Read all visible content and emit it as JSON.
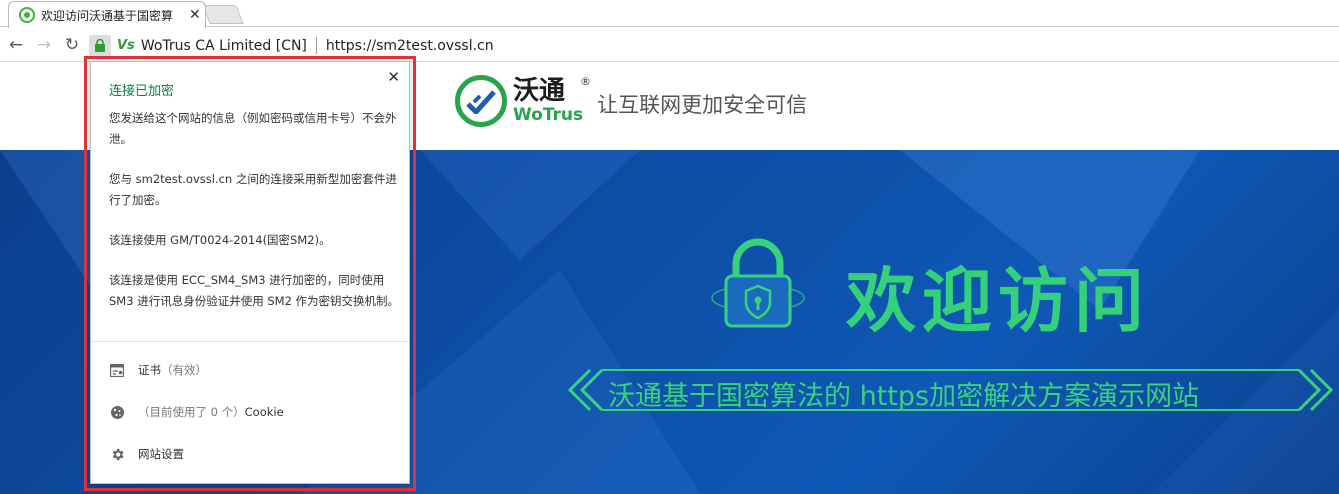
{
  "tab": {
    "title": "欢迎访问沃通基于国密算",
    "close_glyph": "✕"
  },
  "toolbar": {
    "back_glyph": "←",
    "forward_glyph": "→",
    "reload_glyph": "↻",
    "ev_logo_text": "Vs",
    "ev_name": "WoTrus CA Limited [CN]",
    "url": "https://sm2test.ovssl.cn"
  },
  "header": {
    "brand_cn": "沃通",
    "brand_en": "WoTrus",
    "registered": "®",
    "slogan": "让互联网更加安全可信"
  },
  "hero": {
    "title": "欢迎访问",
    "subtitle": "沃通基于国密算法的 https加密解决方案演示网站"
  },
  "popup": {
    "close_glyph": "✕",
    "title": "连接已加密",
    "paragraphs": [
      "您发送给这个网站的信息（例如密码或信用卡号）不会外泄。",
      "您与 sm2test.ovssl.cn 之间的连接采用新型加密套件进行了加密。",
      "该连接使用 GM/T0024-2014(国密SM2)。",
      "该连接是使用 ECC_SM4_SM3 进行加密的，同时使用 SM3 进行讯息身份验证并使用 SM2 作为密钥交换机制。"
    ],
    "certificate_label": "证书",
    "certificate_status": "（有效）",
    "cookie_count_text": "（目前使用了 0 个）",
    "cookie_label": "Cookie",
    "site_settings_label": "网站设置"
  },
  "colors": {
    "accent_green": "#0b8043",
    "brand_green": "#2aa44a",
    "highlight_red": "#e2333a",
    "hero_blue": "#0d4fa6"
  }
}
